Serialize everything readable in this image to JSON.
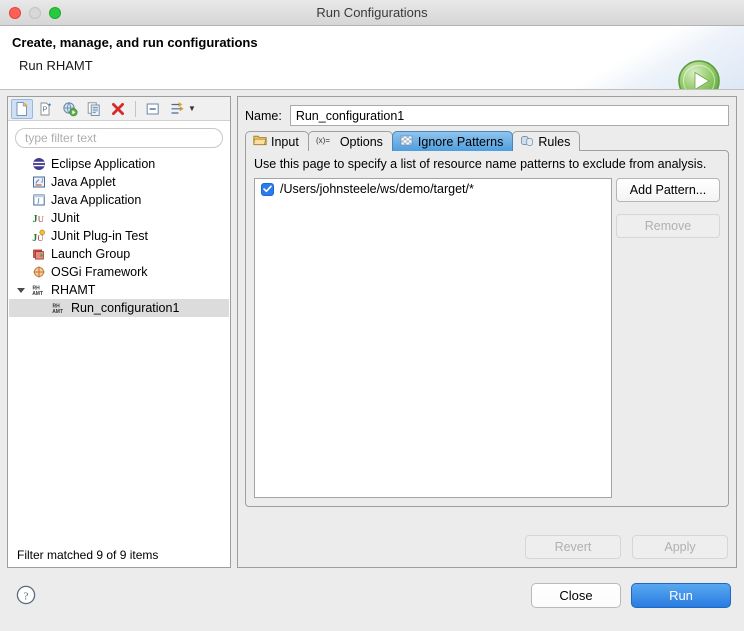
{
  "window": {
    "title": "Run Configurations",
    "traffic_lights": [
      "close",
      "minimize",
      "zoom"
    ]
  },
  "header": {
    "title": "Create, manage, and run configurations",
    "subtitle": "Run RHAMT",
    "badge_icon": "run-play-icon"
  },
  "left_panel": {
    "toolbar": [
      {
        "name": "new-configuration-icon",
        "tooltip": "New launch configuration",
        "pressed": true
      },
      {
        "name": "new-prototype-icon",
        "tooltip": "New prototype",
        "pressed": false
      },
      {
        "name": "export-configuration-icon",
        "tooltip": "Export",
        "pressed": false
      },
      {
        "name": "duplicate-configuration-icon",
        "tooltip": "Duplicate",
        "pressed": false
      },
      {
        "name": "delete-configuration-icon",
        "tooltip": "Delete",
        "pressed": false
      },
      {
        "name": "collapse-all-icon",
        "tooltip": "Collapse All",
        "pressed": false
      },
      {
        "name": "filter-icon",
        "tooltip": "Filter",
        "pressed": false
      }
    ],
    "filter_placeholder": "type filter text",
    "filter_value": "",
    "tree": [
      {
        "label": "Eclipse Application",
        "icon": "eclipse-icon",
        "level": 0,
        "selected": false,
        "expandable": false
      },
      {
        "label": "Java Applet",
        "icon": "java-applet-icon",
        "level": 0,
        "selected": false,
        "expandable": false
      },
      {
        "label": "Java Application",
        "icon": "java-application-icon",
        "level": 0,
        "selected": false,
        "expandable": false
      },
      {
        "label": "JUnit",
        "icon": "junit-icon",
        "level": 0,
        "selected": false,
        "expandable": false
      },
      {
        "label": "JUnit Plug-in Test",
        "icon": "junit-plugin-icon",
        "level": 0,
        "selected": false,
        "expandable": false
      },
      {
        "label": "Launch Group",
        "icon": "launch-group-icon",
        "level": 0,
        "selected": false,
        "expandable": false
      },
      {
        "label": "OSGi Framework",
        "icon": "osgi-icon",
        "level": 0,
        "selected": false,
        "expandable": false
      },
      {
        "label": "RHAMT",
        "icon": "rhamt-icon",
        "level": 0,
        "selected": false,
        "expandable": true,
        "expanded": true
      },
      {
        "label": "Run_configuration1",
        "icon": "rhamt-icon",
        "level": 1,
        "selected": true,
        "expandable": false
      }
    ],
    "status": "Filter matched 9 of 9 items"
  },
  "right_panel": {
    "name_label": "Name:",
    "name_value": "Run_configuration1",
    "tabs": [
      {
        "label": "Input",
        "icon": "folder-icon",
        "active": false
      },
      {
        "label": "Options",
        "icon": "variable-icon",
        "active": false
      },
      {
        "label": "Ignore Patterns",
        "icon": "pattern-icon",
        "active": true
      },
      {
        "label": "Rules",
        "icon": "rules-icon",
        "active": false
      }
    ],
    "description": "Use this page to specify a list of resource name patterns to exclude from analysis.",
    "patterns": [
      {
        "value": "/Users/johnsteele/ws/demo/target/*",
        "checked": true
      }
    ],
    "add_pattern_label": "Add Pattern...",
    "remove_label": "Remove",
    "remove_enabled": false,
    "revert_label": "Revert",
    "revert_enabled": false,
    "apply_label": "Apply",
    "apply_enabled": false
  },
  "bottom": {
    "help_icon": "help-question-icon",
    "close_label": "Close",
    "run_label": "Run"
  },
  "colors": {
    "accent_blue": "#2a7ce0",
    "tab_active": "#4e9ede",
    "dialog_bg": "#ececec",
    "selection": "#dcdcdc"
  }
}
